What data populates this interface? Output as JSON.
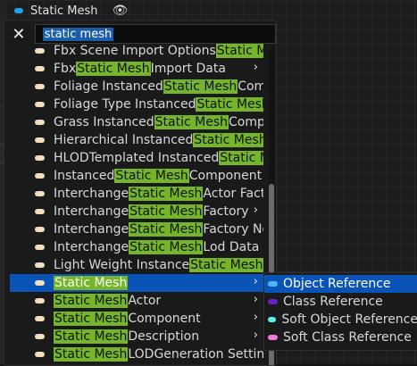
{
  "header": {
    "title": "Static Mesh",
    "pin_color": "#1ea0f0",
    "icon": "eye-icon"
  },
  "search": {
    "value": "static mesh",
    "close_icon": "close-icon"
  },
  "highlight_color": "#75b52a",
  "menu": {
    "items": [
      {
        "pre": "Fbx Scene Import Options ",
        "match": "Static M",
        "post": "",
        "arrow": false
      },
      {
        "pre": "Fbx ",
        "match": "Static Mesh",
        "post": " Import Data",
        "arrow": true
      },
      {
        "pre": "Foliage Instanced ",
        "match": "Static Mesh",
        "post": " Com",
        "arrow": false
      },
      {
        "pre": "Foliage Type Instanced ",
        "match": "Static Mesh",
        "post": "",
        "arrow": false
      },
      {
        "pre": "Grass Instanced ",
        "match": "Static Mesh",
        "post": " Comp",
        "arrow": false
      },
      {
        "pre": "Hierarchical Instanced ",
        "match": "Static Mesh",
        "post": "",
        "arrow": false
      },
      {
        "pre": "HLODTemplated Instanced ",
        "match": "Static M",
        "post": "",
        "arrow": false
      },
      {
        "pre": "Instanced ",
        "match": "Static Mesh",
        "post": " Component",
        "arrow": false
      },
      {
        "pre": "Interchange ",
        "match": "Static Mesh",
        "post": " Actor Fact",
        "arrow": false
      },
      {
        "pre": "Interchange ",
        "match": "Static Mesh",
        "post": " Factory",
        "arrow": true
      },
      {
        "pre": "Interchange ",
        "match": "Static Mesh",
        "post": " Factory No",
        "arrow": false
      },
      {
        "pre": "Interchange ",
        "match": "Static Mesh",
        "post": " Lod Data I",
        "arrow": false
      },
      {
        "pre": "Light Weight Instance ",
        "match": "Static Mesh",
        "post": "",
        "arrow": false
      },
      {
        "pre": "",
        "match": "Static Mesh",
        "post": "",
        "arrow": true,
        "selected": true
      },
      {
        "pre": "",
        "match": "Static Mesh",
        "post": " Actor",
        "arrow": true
      },
      {
        "pre": "",
        "match": "Static Mesh",
        "post": " Component",
        "arrow": true
      },
      {
        "pre": "",
        "match": "Static Mesh",
        "post": " Description",
        "arrow": true
      },
      {
        "pre": "",
        "match": "Static Mesh",
        "post": " LODGeneration Setting",
        "arrow": false
      }
    ]
  },
  "submenu": {
    "items": [
      {
        "label": "Object Reference",
        "color": "#4fb6f0",
        "selected": true
      },
      {
        "label": "Class Reference",
        "color": "#6a1fc8",
        "selected": false
      },
      {
        "label": "Soft Object Reference",
        "color": "#5cf0ee",
        "selected": false
      },
      {
        "label": "Soft Class Reference",
        "color": "#f07ad8",
        "selected": false
      }
    ]
  }
}
